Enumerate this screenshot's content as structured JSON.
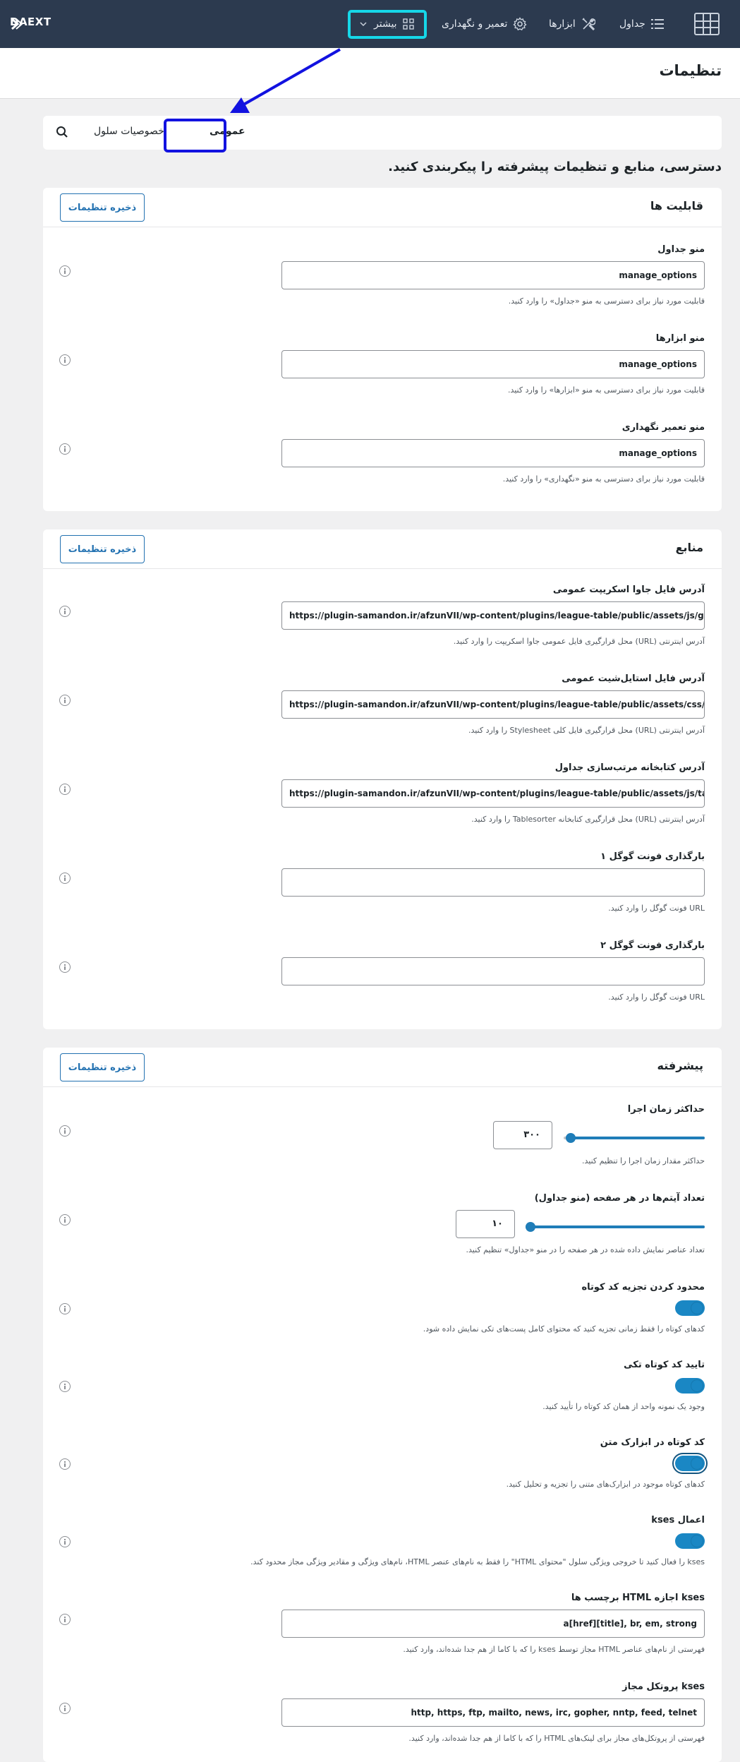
{
  "topbar": {
    "brand": "DAEXT",
    "nav": {
      "tables": "جداول",
      "tools": "ابزارها",
      "maintenance": "تعمیر و نگهداری",
      "more": "بیشتر"
    }
  },
  "page": {
    "title": "تنظیمات",
    "description": "دسترسی، منابع و تنظیمات پیشرفته را پیکربندی کنید."
  },
  "tabs": {
    "general": "عمومی",
    "cell_properties": "خصوصیات سلول"
  },
  "save_label": "ذخیره تنظیمات",
  "capabilities": {
    "title": "قابلیت ها",
    "fields": [
      {
        "label": "منو جداول",
        "value": "manage_options",
        "desc": "قابلیت مورد نیاز برای دسترسی به منو «جداول» را وارد کنید."
      },
      {
        "label": "منو ابزارها",
        "value": "manage_options",
        "desc": "قابلیت مورد نیاز برای دسترسی به منو «ابزارها» را وارد کنید."
      },
      {
        "label": "منو تعمیر نگهداری",
        "value": "manage_options",
        "desc": "قابلیت مورد نیاز برای دسترسی به منو «نگهداری» را وارد کنید."
      }
    ]
  },
  "resources": {
    "title": "منابع",
    "fields": [
      {
        "label": "آدرس فایل جاوا اسکریپت عمومی",
        "value": "https://plugin-samandon.ir/afzunVII/wp-content/plugins/league-table/public/assets/js/general-min.js",
        "desc": "آدرس اینترنتی (URL) محل قرارگیری فایل عمومی جاوا اسکریپت را وارد کنید."
      },
      {
        "label": "آدرس فایل استایل‌شیت عمومی",
        "value": "https://plugin-samandon.ir/afzunVII/wp-content/plugins/league-table/public/assets/css/general-min.css",
        "desc": "آدرس اینترنتی (URL) محل قرارگیری فایل کلی Stylesheet را وارد کنید."
      },
      {
        "label": "آدرس کتابخانه مرتب‌سازی جداول",
        "value": "https://plugin-samandon.ir/afzunVII/wp-content/plugins/league-table/public/assets/js/tablesorter/jquery.tablesorter-min.js",
        "desc": "آدرس اینترنتی (URL) محل قرارگیری کتابخانه Tablesorter را وارد کنید."
      },
      {
        "label": "بارگذاری فونت گوگل ۱",
        "value": "",
        "desc": "URL فونت گوگل را وارد کنید."
      },
      {
        "label": "بارگذاری فونت گوگل ۲",
        "value": "",
        "desc": "URL فونت گوگل را وارد کنید."
      }
    ]
  },
  "advanced": {
    "title": "پیشرفته",
    "max_execution": {
      "label": "حداکثر زمان اجرا",
      "value": "۳۰۰",
      "level": 0.95,
      "desc": "حداکثر مقدار زمان اجرا را تنظیم کنید."
    },
    "items_per_page": {
      "label": "تعداد آیتم‌ها در هر صفحه (منو جداول)",
      "value": "۱۰",
      "level": 1.0,
      "desc": "تعداد عناصر نمایش داده شده در هر صفحه را در منو «جداول» تنظیم کنید."
    },
    "toggles": [
      {
        "label": "محدود کردن تجزیه کد کوتاه",
        "desc": "کدهای کوتاه را فقط زمانی تجزیه کنید که محتوای کامل پست‌های تکی نمایش داده شود.",
        "on": true
      },
      {
        "label": "تایید کد کوتاه تکی",
        "desc": "وجود یک نمونه واحد از همان کد کوتاه را تأیید کنید.",
        "on": true
      },
      {
        "label": "کد کوتاه در ابزارک متن",
        "desc": "کدهای کوتاه موجود در ابزارک‌های متنی را تجزیه و تحلیل کنید.",
        "on": true
      },
      {
        "label": "اعمال kses",
        "desc": "kses را فعال کنید تا خروجی ویژگی سلول \"محتوای HTML\" را فقط به نام‌های عنصر HTML، نام‌های ویژگی و مقادیر ویژگی مجاز محدود کند.",
        "on": true
      }
    ],
    "kses_tags": {
      "label": "kses اجازه HTML برچسب ها",
      "value": "a[href][title], br, em, strong",
      "desc": "فهرستی از نام‌های عناصر HTML مجاز توسط kses را که با کاما از هم جدا شده‌اند، وارد کنید."
    },
    "kses_protocols": {
      "label": "kses پروتکل مجاز",
      "value": "http, https, ftp, mailto, news, irc, gopher, nntp, feed, telnet",
      "desc": "فهرستی از پروتکل‌های مجاز برای لینک‌های HTML را که با کاما از هم جدا شده‌اند، وارد کنید."
    }
  }
}
